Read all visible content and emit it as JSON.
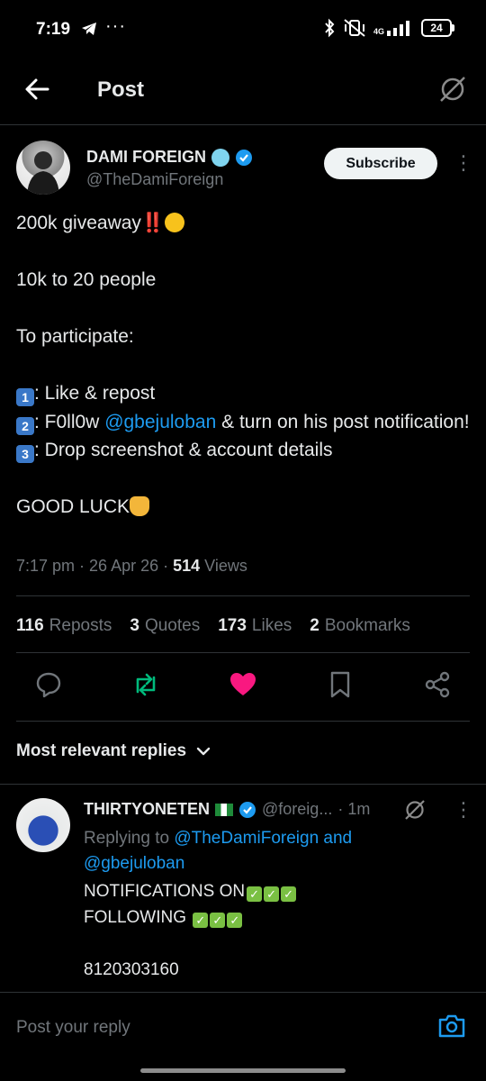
{
  "status_bar": {
    "time": "7:19",
    "network": "4G",
    "battery": "24"
  },
  "header": {
    "title": "Post",
    "back_icon": "arrow-left-icon",
    "grok_icon": "grok-icon"
  },
  "post": {
    "author_name": "DAMI FOREIGN",
    "author_handle": "@TheDamiForeign",
    "subscribe_label": "Subscribe",
    "line1": "200k giveaway",
    "line2": "10k to 20 people",
    "line3": "To participate:",
    "step1": ": Like & repost",
    "step2_prefix": ": F0ll0w ",
    "step2_mention": "@gbejuloban",
    "step2_suffix": " & turn on his post notification!",
    "step3": ": Drop screenshot & account details",
    "closing": "GOOD LUCK",
    "step1_num": "1",
    "step2_num": "2",
    "step3_num": "3",
    "time": "7:17 pm",
    "date": "26 Apr 26",
    "views_count": "514",
    "views_label": "Views"
  },
  "stats": {
    "reposts_count": "116",
    "reposts_label": "Reposts",
    "quotes_count": "3",
    "quotes_label": "Quotes",
    "likes_count": "173",
    "likes_label": "Likes",
    "bookmarks_count": "2",
    "bookmarks_label": "Bookmarks"
  },
  "colors": {
    "accent": "#1d9bf0",
    "repost": "#00ba7c",
    "like": "#f91880",
    "verified": "#1d9bf0"
  },
  "replies_filter": "Most relevant replies",
  "reply": {
    "name": "THIRTYONETEN",
    "handle": "@foreig...",
    "time": "· 1m",
    "replying_prefix": "Replying to ",
    "replying_mention1": "@TheDamiForeign",
    "replying_and": " and",
    "replying_mention2": "@gbejuloban",
    "line1": "NOTIFICATIONS ON",
    "line2": "FOLLOWING ",
    "line3": "8120303160"
  },
  "composer": {
    "placeholder": "Post your reply",
    "camera_icon": "camera-icon"
  }
}
